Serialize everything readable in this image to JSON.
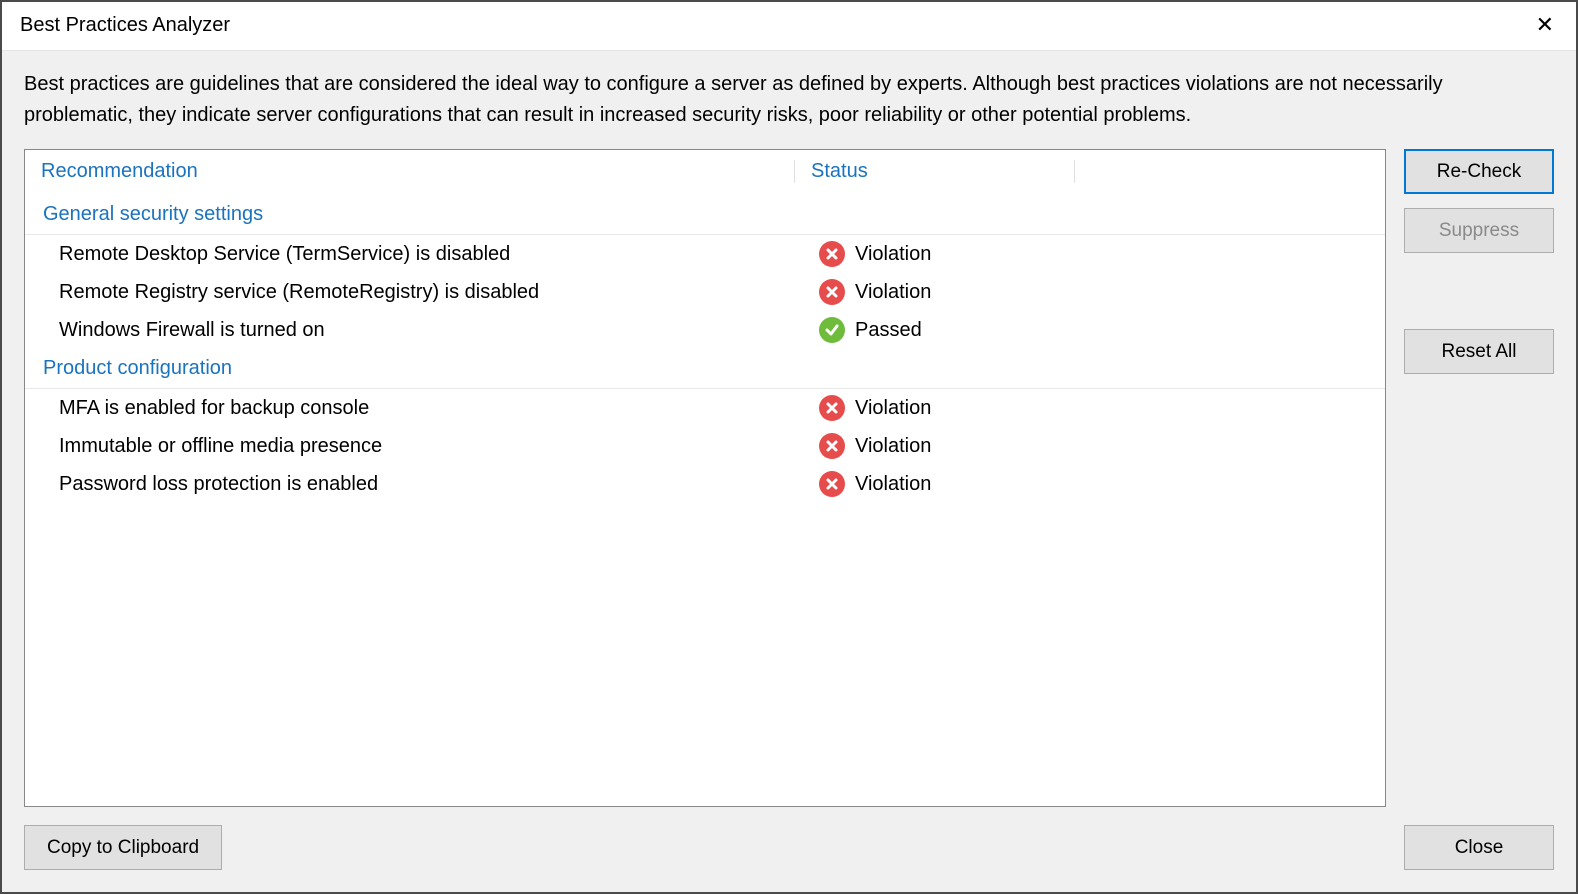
{
  "window": {
    "title": "Best Practices Analyzer"
  },
  "description": "Best practices are guidelines that are considered the ideal way to configure a server as defined by experts. Although best practices violations are not necessarily problematic, they indicate server configurations that can result in increased security risks, poor reliability or other potential problems.",
  "columns": {
    "recommendation": "Recommendation",
    "status": "Status"
  },
  "groups": [
    {
      "title": "General security settings",
      "items": [
        {
          "label": "Remote Desktop Service (TermService) is disabled",
          "status": "Violation",
          "passed": false
        },
        {
          "label": "Remote Registry service (RemoteRegistry) is disabled",
          "status": "Violation",
          "passed": false
        },
        {
          "label": "Windows Firewall is turned on",
          "status": "Passed",
          "passed": true
        }
      ]
    },
    {
      "title": "Product configuration",
      "items": [
        {
          "label": "MFA is enabled for backup console",
          "status": "Violation",
          "passed": false
        },
        {
          "label": "Immutable or offline media presence",
          "status": "Violation",
          "passed": false
        },
        {
          "label": "Password loss protection is enabled",
          "status": "Violation",
          "passed": false
        }
      ]
    }
  ],
  "buttons": {
    "recheck": "Re-Check",
    "suppress": "Suppress",
    "reset_all": "Reset All",
    "copy": "Copy to Clipboard",
    "close": "Close"
  }
}
